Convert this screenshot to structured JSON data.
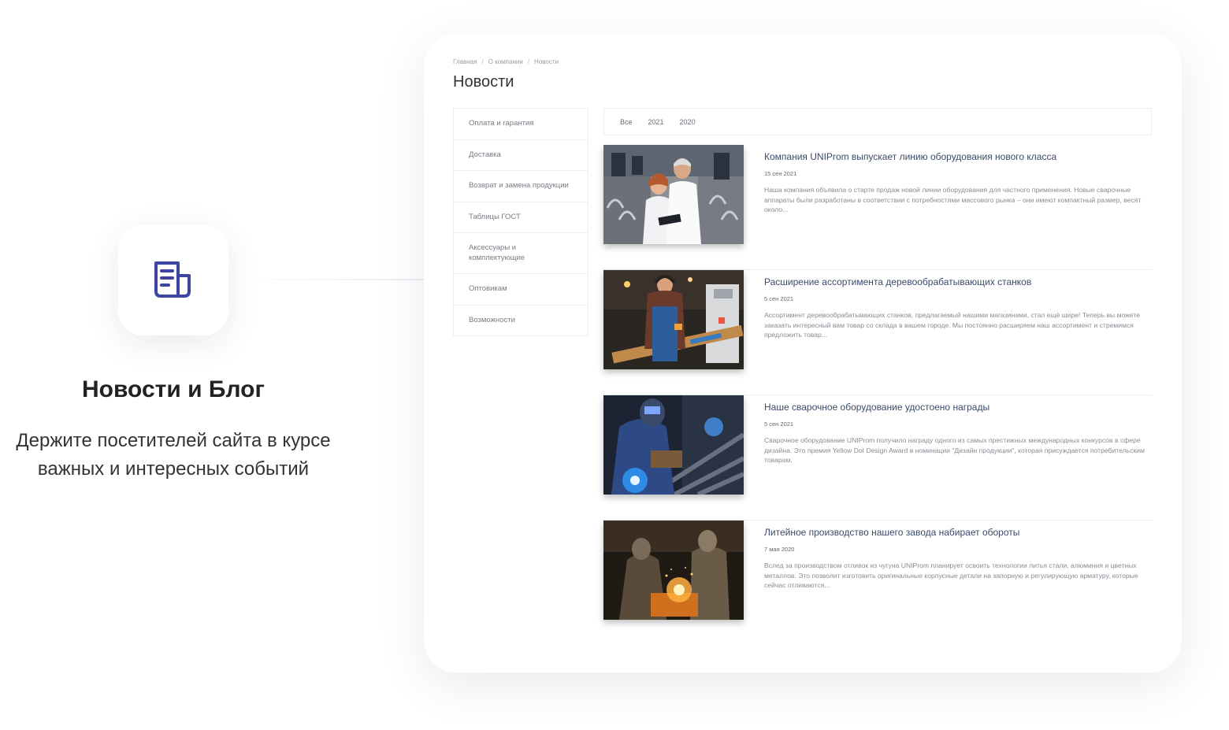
{
  "promo": {
    "icon": "newspaper-icon",
    "title": "Новости и Блог",
    "subtitle_line1": "Держите посетителей сайта в курсе",
    "subtitle_line2": "важных и интересных событий"
  },
  "colors": {
    "accent": "#3d45a0",
    "title_text": "#3a4a6a",
    "muted_text": "#8a8a95"
  },
  "breadcrumb": [
    "Главная",
    "О компании",
    "Новости"
  ],
  "page_title": "Новости",
  "side_menu": [
    "Оплата и гарантия",
    "Доставка",
    "Возврат и замена продукции",
    "Таблицы ГОСТ",
    "Аксессуары и комплектующие",
    "Оптовикам",
    "Возможности"
  ],
  "filters": [
    "Все",
    "2021",
    "2020"
  ],
  "news": [
    {
      "title": "Компания UNIProm выпускает линию оборудования нового класса",
      "date": "15 сен 2021",
      "text": "Наша компания объявила о старте продаж новой линии оборудования для частного применения. Новые сварочные аппараты были разработаны в соответствии с потребностями массового рынка – они имеют компактный размер, весят около..."
    },
    {
      "title": "Расширение ассортимента деревообрабатывающих станков",
      "date": "5 сен 2021",
      "text": "Ассортимент деревообрабатывающих станков, предлагаемый нашими магазинами, стал ещё шире! Теперь вы можете заказать интересный вам товар со склада в вашем городе. Мы постоянно расширяем наш ассортимент и стремимся предложить товар..."
    },
    {
      "title": "Наше сварочное оборудование удостоено награды",
      "date": "5 сен 2021",
      "text": "Сварочное оборудование UNIProm получило награду одного из самых престижных международных конкурсов в сфере дизайна. Это премия Yellow Dot Design Award в номинации \"Дизайн продукции\", которая присуждается потребительским товарам."
    },
    {
      "title": "Литейное производство нашего завода набирает обороты",
      "date": "7 мая 2020",
      "text": "Вслед за производством отливок из чугуна UNIProm планирует освоить технологии литья стали, алюминия и цветных металлов. Это позволит изготовить оригинальные корпусные детали на запорную и регулирующую арматуру, которые сейчас отливаются..."
    }
  ]
}
